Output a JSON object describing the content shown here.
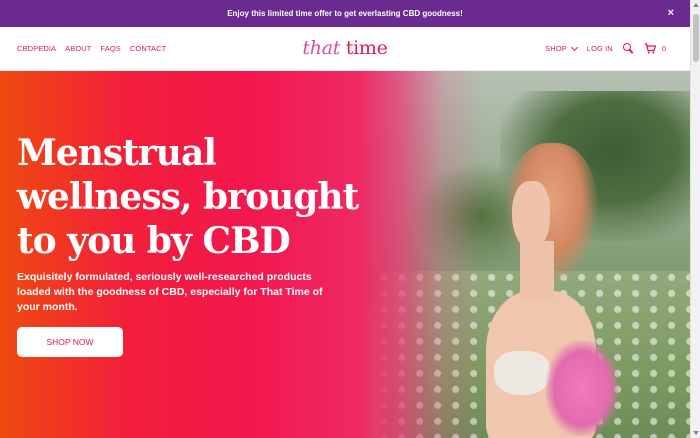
{
  "announcement": {
    "text": "Enjoy this limited time offer to get everlasting CBD goodness!",
    "close_glyph": "×"
  },
  "nav": {
    "left_links": [
      "CBDPEDIA",
      "ABOUT",
      "FAQS",
      "CONTACT"
    ],
    "logo": {
      "part1": "that",
      "part2": " time"
    },
    "shop_label": "SHOP",
    "login_label": "LOG IN",
    "cart_count": "0"
  },
  "hero": {
    "title": "Menstrual wellness, brought to you by CBD",
    "subtitle": "Exquisitely formulated, seriously well-researched products loaded with the goodness of CBD, especially for That Time of your month.",
    "cta_label": "SHOP NOW"
  },
  "colors": {
    "announcement_bg": "#6a2a8f",
    "accent": "#e0194e",
    "logo_pink": "#d94ea3",
    "hero_orange": "#f04a0f",
    "hero_pink": "#f3174d"
  },
  "icons": [
    "close-icon",
    "chevron-down-icon",
    "search-icon",
    "cart-icon"
  ]
}
